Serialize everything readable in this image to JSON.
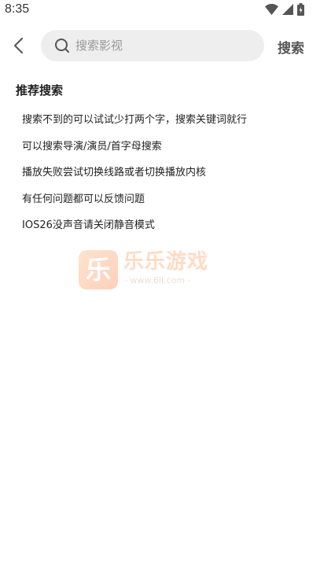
{
  "status_bar": {
    "time": "8:35"
  },
  "header": {
    "search_placeholder": "搜索影视",
    "search_button_label": "搜索"
  },
  "recommend": {
    "title": "推荐搜索",
    "tips": [
      "搜索不到的可以试试少打两个字，搜索关键词就行",
      "可以搜索导演/演员/首字母搜索",
      "播放失败尝试切换线路或者切换播放内核",
      "有任何问题都可以反馈问题",
      "IOS26没声音请关闭静音模式"
    ]
  },
  "watermark": {
    "logo_char": "乐",
    "brand": "乐乐游戏",
    "url": "- www.6ll.com -"
  }
}
